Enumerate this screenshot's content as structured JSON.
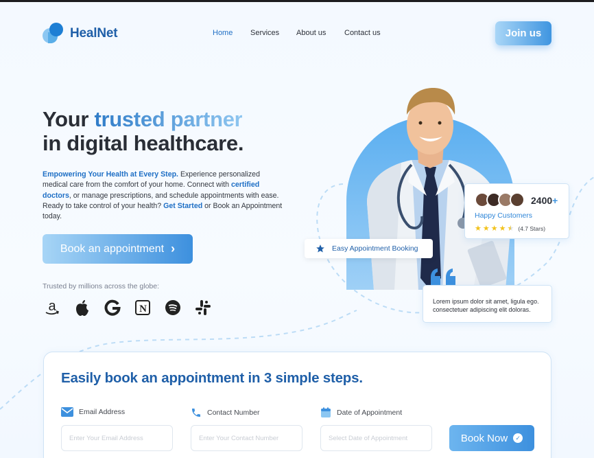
{
  "brand": {
    "name": "HealNet"
  },
  "nav": {
    "items": [
      {
        "label": "Home",
        "active": true
      },
      {
        "label": "Services",
        "active": false
      },
      {
        "label": "About us",
        "active": false
      },
      {
        "label": "Contact us",
        "active": false
      }
    ],
    "cta": "Join us"
  },
  "hero": {
    "title_part1": "Your ",
    "title_highlight": "trusted partner",
    "title_part2": "in digital healthcare.",
    "desc_lead": "Empowering Your Health at Every Step.",
    "desc_1": " Experience personalized medical care from the comfort of your home. Connect with ",
    "desc_link1": "certified doctors",
    "desc_2": ", or manage prescriptions, and schedule appointments with ease. Ready to take control of your health? ",
    "desc_link2": "Get Started",
    "desc_3": " or Book an Appointment today.",
    "cta": "Book an appointment",
    "trusted": "Trusted by millions across the globe:",
    "brands": [
      "amazon-icon",
      "apple-icon",
      "google-icon",
      "notion-icon",
      "spotify-icon",
      "slack-icon"
    ]
  },
  "floating": {
    "booking_badge": "Easy Appointment Booking",
    "customers_count": "2400",
    "customers_plus": "+",
    "customers_label": "Happy Customers",
    "rating_text": "(4.7 Stars)",
    "rating": 4.5,
    "quote": "Lorem ipsum dolor sit amet, ligula ego. consectetuer adipiscing elit doloras."
  },
  "booking": {
    "title": "Easily book an appointment in 3 simple steps.",
    "fields": [
      {
        "label": "Email Address",
        "placeholder": "Enter Your Email Address",
        "icon": "mail-icon"
      },
      {
        "label": "Contact Number",
        "placeholder": "Enter Your Contact Number",
        "icon": "phone-icon"
      },
      {
        "label": "Date of Appointment",
        "placeholder": "Select Date of Appointment",
        "icon": "calendar-icon"
      }
    ],
    "submit": "Book Now"
  },
  "colors": {
    "primary": "#1f5fa8",
    "accent": "#3d90de",
    "star": "#f2c21b"
  }
}
